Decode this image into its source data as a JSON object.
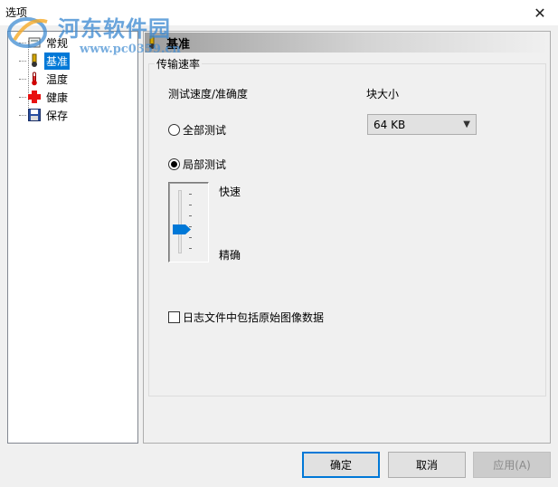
{
  "window": {
    "title": "选项",
    "close_glyph": "✕"
  },
  "watermark": {
    "title": "河东软件园",
    "url": "www.pc0359.cn",
    "icon": "hedong-logo"
  },
  "sidebar": {
    "items": [
      {
        "label": "常规",
        "icon": "general-icon"
      },
      {
        "label": "基准",
        "icon": "benchmark-icon",
        "selected": true
      },
      {
        "label": "温度",
        "icon": "thermometer-icon"
      },
      {
        "label": "健康",
        "icon": "health-cross-icon"
      },
      {
        "label": "保存",
        "icon": "floppy-disk-icon"
      }
    ]
  },
  "panel": {
    "header_title": "基准",
    "group_title": "传输速率",
    "speed_accuracy_label": "测试速度/准确度",
    "block_size_label": "块大小",
    "block_size_value": "64 KB",
    "full_test_label": "全部测试",
    "full_test_selected": false,
    "partial_test_label": "局部测试",
    "partial_test_selected": true,
    "slider_top_label": "快速",
    "slider_bottom_label": "精确",
    "slider_tick_count": 6,
    "slider_selected_tick": 5,
    "raw_data_label": "日志文件中包括原始图像数据",
    "raw_data_checked": false
  },
  "buttons": {
    "ok": "确定",
    "cancel": "取消",
    "apply": "应用(A)"
  },
  "colors": {
    "accent": "#0078d7",
    "watermark": "#408cd2"
  }
}
